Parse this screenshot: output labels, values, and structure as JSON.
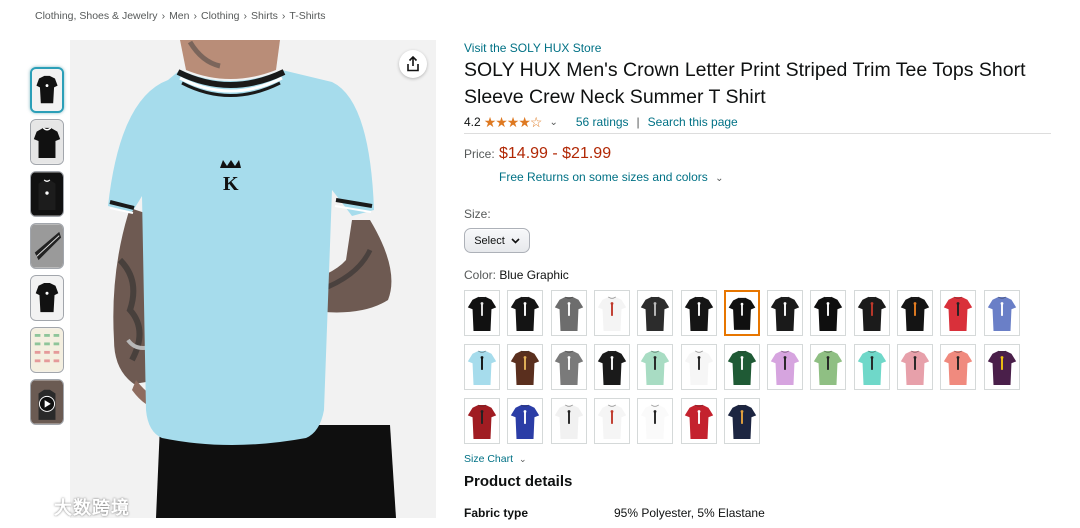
{
  "breadcrumb": [
    "Clothing, Shoes & Jewelry",
    "Men",
    "Clothing",
    "Shirts",
    "T-Shirts"
  ],
  "breadcrumb_separator": "›",
  "product": {
    "store_link": "Visit the SOLY HUX Store",
    "title": "SOLY HUX Men's Crown Letter Print Striped Trim Tee Tops Short Sleeve Crew Neck Summer T Shirt",
    "rating": "4.2",
    "stars_display": "★★★★☆",
    "ratings_count": "56 ratings",
    "search_page": "Search this page",
    "price_label": "Price:",
    "price": "$14.99 - $21.99",
    "free_returns": "Free Returns on some sizes and colors",
    "size_label": "Size:",
    "size_select": "Select",
    "color_label": "Color:",
    "color_value": "Blue Graphic",
    "size_chart": "Size Chart",
    "details_heading": "Product details",
    "fabric_key": "Fabric type",
    "fabric_value": "95% Polyester, 5% Elastane"
  },
  "watermark": "大数跨境",
  "colors": {
    "link": "#007185",
    "price": "#B12704",
    "star": "#de7921",
    "selected_border": "#e77600",
    "shirt_main": "#a6dcec"
  },
  "swatches": [
    [
      "#111111",
      "#e8e8e8"
    ],
    [
      "#141414",
      "#ffffff"
    ],
    [
      "#6d6d6d",
      "#ffffff"
    ],
    [
      "#f4f4f4",
      "#c0392b"
    ],
    [
      "#2c2c2c",
      "#bbbbbb"
    ],
    [
      "#151515",
      "#ffffff"
    ],
    [
      "#101010",
      "#ffffff"
    ],
    [
      "#1a1a1a",
      "#ffffff"
    ],
    [
      "#0f0f0f",
      "#ffffff"
    ],
    [
      "#1b1b1b",
      "#c0392b"
    ],
    [
      "#141414",
      "#e67e22"
    ],
    [
      "#d9303a",
      "#222222"
    ],
    [
      "#6a7fc7",
      "#ffffff"
    ],
    [
      "#a6dcec",
      "#111111"
    ],
    [
      "#5a2f1e",
      "#e6b35a"
    ],
    [
      "#7a7a7a",
      "#ffffff"
    ],
    [
      "#1a1a1a",
      "#ffffff"
    ],
    [
      "#a8dcc3",
      "#222222"
    ],
    [
      "#f6f6f6",
      "#222222"
    ],
    [
      "#1f5a35",
      "#ffffff"
    ],
    [
      "#d6a4df",
      "#222222"
    ],
    [
      "#8fbf83",
      "#222222"
    ],
    [
      "#6fd8c9",
      "#222222"
    ],
    [
      "#e7a0aa",
      "#222222"
    ],
    [
      "#f08a7e",
      "#222222"
    ],
    [
      "#4a1f4a",
      "#f1c40f"
    ],
    [
      "#a01c22",
      "#222222"
    ],
    [
      "#2b3da6",
      "#ffffff"
    ],
    [
      "#f1f1f1",
      "#222222"
    ],
    [
      "#f5f5f5",
      "#c0392b"
    ],
    [
      "#fafafa",
      "#222222"
    ],
    [
      "#c4222e",
      "#ffffff"
    ],
    [
      "#1c2541",
      "#e6a33e"
    ]
  ]
}
